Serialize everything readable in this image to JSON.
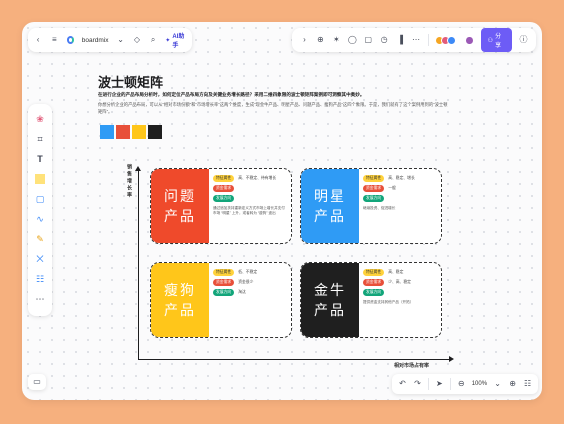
{
  "toolbar": {
    "brand": "boardmix",
    "ai_label": "AI助手",
    "share_label": "分享",
    "left_icons": [
      "back-icon",
      "menu-icon",
      "tag-icon",
      "search-icon"
    ],
    "right_icons": [
      "chevron-icon",
      "add-icon",
      "template-icon",
      "comment-icon",
      "chat-icon",
      "timer-icon",
      "chart-icon",
      "more-icon"
    ],
    "avatar_colors": [
      "#f5a623",
      "#e25b7a",
      "#3d8af7",
      "#9b59b6"
    ],
    "help_icon": "help-icon"
  },
  "tools": [
    "palette-icon",
    "frame-icon",
    "text-icon",
    "sticky-note-icon",
    "shape-icon",
    "connector-icon",
    "pen-icon",
    "mindmap-icon",
    "table-icon",
    "more-icon"
  ],
  "bottom": {
    "zoom": "100%"
  },
  "doc": {
    "title": "波士顿矩阵",
    "subtitle": "在进行企业的产品布局分析时，如何定位产品布局方向及关键业务增长路径？采用二维四象限的波士顿矩阵案例即可洞察其中奥妙。",
    "desc": "你想分析企业的产品布局，可以从“相对市场份额”和“市场增长率”这两个维度，生成“现金牛产品、明星产品、问题产品、瘦狗产品”这四个象限。于是，我们就有了这个案例用到的“波士顿矩阵”。",
    "swatch_colors": [
      "#2f9bf5",
      "#e8503a",
      "#ffc61a",
      "#1f1f1f"
    ]
  },
  "axes": {
    "y_label": "销售增长率",
    "x_label": "相对市场占有率"
  },
  "quadrants": [
    {
      "id": "question",
      "title": "问题产品",
      "color": "#ef4a2b",
      "rows": [
        {
          "tag": "特征属性",
          "text": "高、不稳定、待有增长"
        },
        {
          "tag": "资金需求",
          "text": ""
        },
        {
          "tag": "发展方向",
          "text": ""
        }
      ],
      "note": "通过追加扶持重新定义方式市场上增长并支付市场 “明星” 上升，或者转为 “瘦狗” 逐出"
    },
    {
      "id": "star",
      "title": "明星产品",
      "color": "#2f9bf5",
      "rows": [
        {
          "tag": "特征属性",
          "text": "高、稳定、增长"
        },
        {
          "tag": "资金需求",
          "text": "一般"
        },
        {
          "tag": "发展方向",
          "text": ""
        }
      ],
      "note": "继续投资、促进增长"
    },
    {
      "id": "dog",
      "title": "瘦狗产品",
      "color": "#ffc61a",
      "rows": [
        {
          "tag": "特征属性",
          "text": "低、不稳定"
        },
        {
          "tag": "资金需求",
          "text": "资金很少"
        },
        {
          "tag": "发展方向",
          "text": "淘汰"
        }
      ],
      "note": ""
    },
    {
      "id": "cash",
      "title": "金牛产品",
      "color": "#1f1f1f",
      "rows": [
        {
          "tag": "特征属性",
          "text": "高、稳定"
        },
        {
          "tag": "资金需求",
          "text": "少、高、稳定"
        },
        {
          "tag": "发展方向",
          "text": ""
        }
      ],
      "note": "提供资金支持其他产品（开拓）"
    }
  ]
}
